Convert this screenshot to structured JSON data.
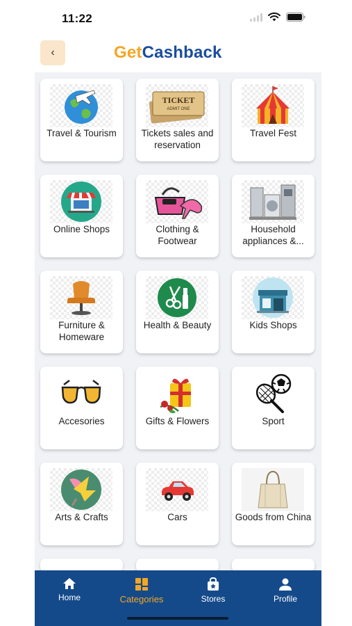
{
  "status_bar": {
    "time": "11:22"
  },
  "header": {
    "back_icon": "chevron-left-icon",
    "logo_part1": "Get",
    "logo_part2": "Cashback"
  },
  "categories": [
    {
      "label": "Travel & Tourism",
      "icon": "globe-plane-icon"
    },
    {
      "label": "Tickets sales and reservation",
      "icon": "ticket-icon"
    },
    {
      "label": "Travel Fest",
      "icon": "circus-tent-icon"
    },
    {
      "label": "Online Shops",
      "icon": "online-store-icon"
    },
    {
      "label": "Clothing & Footwear",
      "icon": "handbag-shoe-icon"
    },
    {
      "label": "Household appliances &...",
      "icon": "appliances-icon"
    },
    {
      "label": "Furniture & Homeware",
      "icon": "armchair-icon"
    },
    {
      "label": "Health & Beauty",
      "icon": "cosmetics-icon"
    },
    {
      "label": "Kids Shops",
      "icon": "kids-store-icon"
    },
    {
      "label": "Accesories",
      "icon": "sunglasses-icon"
    },
    {
      "label": "Gifts & Flowers",
      "icon": "gift-flowers-icon"
    },
    {
      "label": "Sport",
      "icon": "tennis-ball-icon"
    },
    {
      "label": "Arts & Crafts",
      "icon": "crafts-icon"
    },
    {
      "label": "Cars",
      "icon": "car-icon"
    },
    {
      "label": "Goods from China",
      "icon": "bag-icon"
    }
  ],
  "tab_bar": {
    "home": "Home",
    "categories": "Categories",
    "stores": "Stores",
    "profile": "Profile"
  },
  "colors": {
    "brand_blue": "#154a8a",
    "accent_orange": "#f5a623"
  }
}
